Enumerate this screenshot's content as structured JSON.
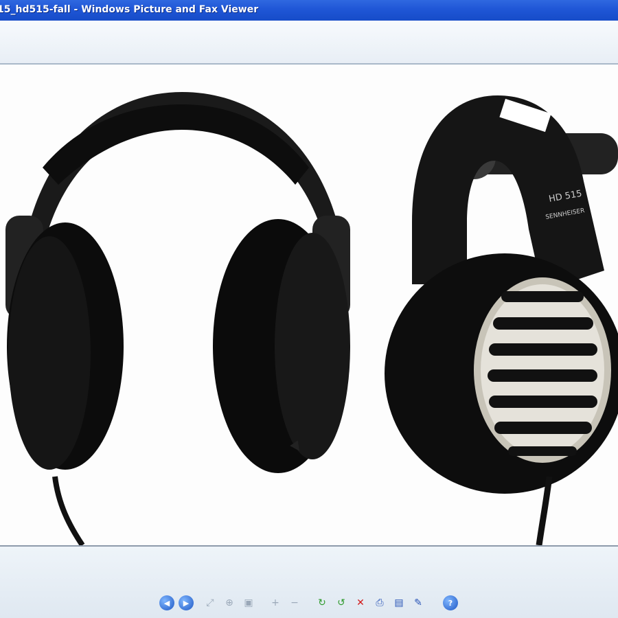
{
  "window": {
    "title": "15_hd515-fall - Windows Picture and Fax Viewer"
  },
  "image": {
    "headphone_right_model": "HD 515",
    "headphone_right_brand": "SENNHEISER"
  },
  "toolbar": {
    "buttons": [
      {
        "name": "previous-image-icon",
        "glyph": "◀"
      },
      {
        "name": "next-image-icon",
        "glyph": "▶"
      },
      {
        "name": "best-fit-icon",
        "glyph": "⤢"
      },
      {
        "name": "actual-size-icon",
        "glyph": "⊕"
      },
      {
        "name": "slideshow-icon",
        "glyph": "▣"
      },
      {
        "name": "zoom-in-icon",
        "glyph": "+"
      },
      {
        "name": "zoom-out-icon",
        "glyph": "−"
      },
      {
        "name": "rotate-clockwise-icon",
        "glyph": "↻"
      },
      {
        "name": "rotate-counterclockwise-icon",
        "glyph": "↺"
      },
      {
        "name": "delete-icon",
        "glyph": "✕"
      },
      {
        "name": "print-icon",
        "glyph": "⎙"
      },
      {
        "name": "save-icon",
        "glyph": "▤"
      },
      {
        "name": "edit-icon",
        "glyph": "✎"
      },
      {
        "name": "help-icon",
        "glyph": "?"
      }
    ]
  },
  "colors": {
    "titlebar": "#1f56d6",
    "accent": "#2753b6"
  }
}
